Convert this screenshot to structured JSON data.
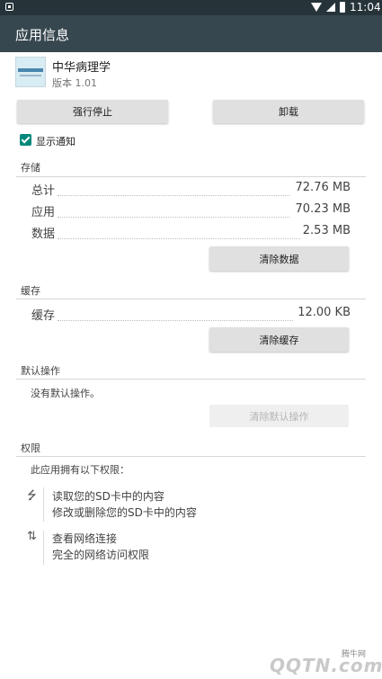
{
  "status_bar": {
    "time": "11:04"
  },
  "app_bar": {
    "title": "应用信息"
  },
  "app": {
    "name": "中华病理学",
    "version": "版本 1.01"
  },
  "actions": {
    "force_stop": "强行停止",
    "uninstall": "卸载"
  },
  "notifications": {
    "label": "显示通知",
    "checked": true
  },
  "storage": {
    "header": "存储",
    "rows": [
      {
        "label": "总计",
        "value": "72.76 MB"
      },
      {
        "label": "应用",
        "value": "70.23 MB"
      },
      {
        "label": "数据",
        "value": "2.53 MB"
      }
    ],
    "clear_button": "清除数据"
  },
  "cache": {
    "header": "缓存",
    "rows": [
      {
        "label": "缓存",
        "value": "12.00 KB"
      }
    ],
    "clear_button": "清除缓存"
  },
  "defaults": {
    "header": "默认操作",
    "text": "没有默认操作。",
    "clear_button": "清除默认操作"
  },
  "permissions": {
    "header": "权限",
    "intro": "此应用拥有以下权限：",
    "groups": [
      {
        "icon": "usb-icon",
        "lines": [
          "读取您的SD卡中的内容",
          "修改或删除您的SD卡中的内容"
        ]
      },
      {
        "icon": "network-arrows-icon",
        "lines": [
          "查看网络连接",
          "完全的网络访问权限"
        ]
      }
    ]
  },
  "watermark": {
    "logo": "QQTN.com",
    "name": "腾牛网"
  },
  "colors": {
    "status_bar": "#26343a",
    "app_bar": "#37474f",
    "accent": "#00897b",
    "button": "#e0e0e0"
  }
}
